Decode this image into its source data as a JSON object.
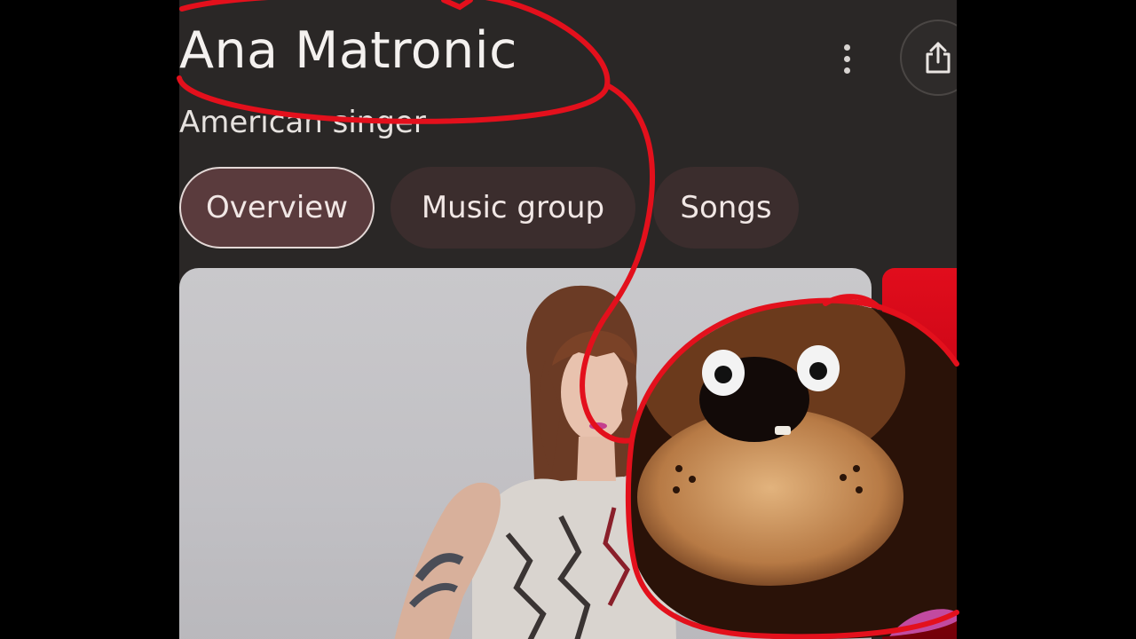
{
  "knowledge_panel": {
    "title": "Ana Matronic",
    "subtitle": "American singer"
  },
  "header_actions": {
    "more_icon": "more-vertical-icon",
    "share_icon": "share-icon"
  },
  "tabs": [
    {
      "label": "Overview",
      "selected": true
    },
    {
      "label": "Music group",
      "selected": false
    },
    {
      "label": "Songs",
      "selected": false
    }
  ],
  "images": [
    {
      "description": "photo"
    },
    {
      "description": "photo"
    }
  ],
  "colors": {
    "page_background": "#2a2726",
    "active_tab": "#5a3b3d",
    "inactive_tab": "#3b2d2d",
    "annotation_red": "#e3101c"
  }
}
